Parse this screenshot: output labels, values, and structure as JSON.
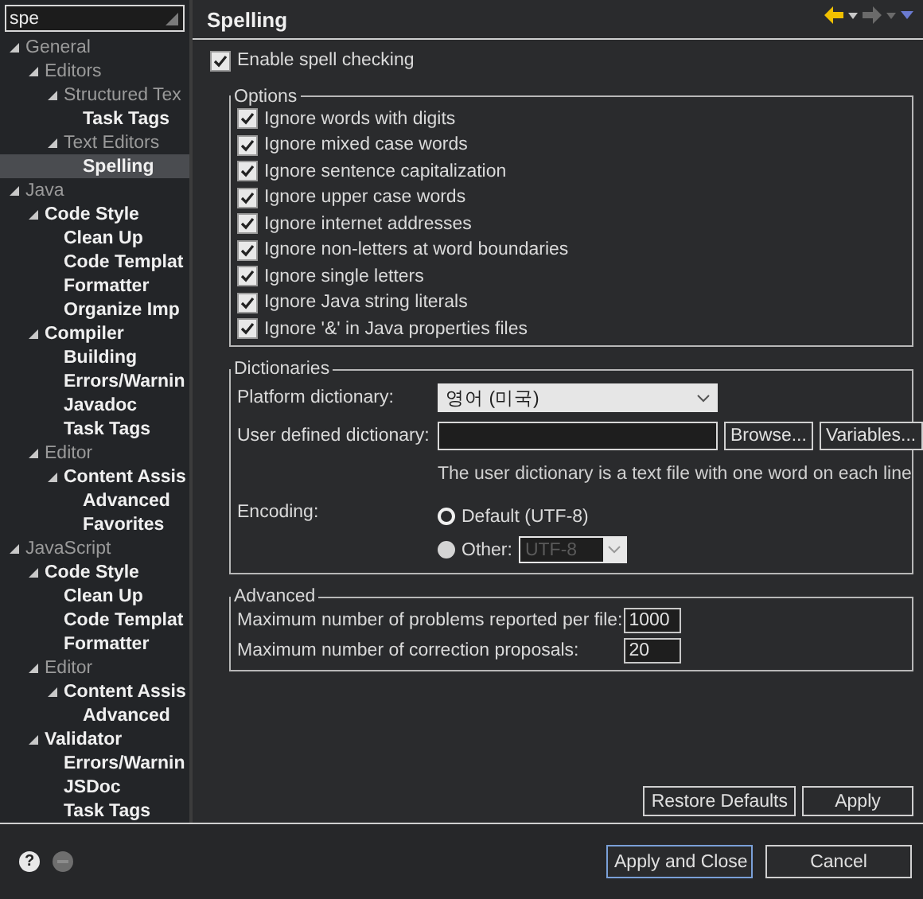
{
  "filter": {
    "value": "spe"
  },
  "tree": [
    {
      "label": "General",
      "matched": false,
      "selected": false,
      "expanded": true,
      "children": [
        {
          "label": "Editors",
          "matched": false,
          "selected": false,
          "expanded": true,
          "children": [
            {
              "label": "Structured Tex",
              "matched": false,
              "selected": false,
              "expanded": true,
              "children": [
                {
                  "label": "Task Tags",
                  "matched": true,
                  "selected": false
                }
              ]
            },
            {
              "label": "Text Editors",
              "matched": false,
              "selected": false,
              "expanded": true,
              "children": [
                {
                  "label": "Spelling",
                  "matched": true,
                  "selected": true
                }
              ]
            }
          ]
        }
      ]
    },
    {
      "label": "Java",
      "matched": false,
      "selected": false,
      "expanded": true,
      "children": [
        {
          "label": "Code Style",
          "matched": true,
          "selected": false,
          "expanded": true,
          "children": [
            {
              "label": "Clean Up",
              "matched": true,
              "selected": false
            },
            {
              "label": "Code Templat",
              "matched": true,
              "selected": false
            },
            {
              "label": "Formatter",
              "matched": true,
              "selected": false
            },
            {
              "label": "Organize Imp",
              "matched": true,
              "selected": false
            }
          ]
        },
        {
          "label": "Compiler",
          "matched": true,
          "selected": false,
          "expanded": true,
          "children": [
            {
              "label": "Building",
              "matched": true,
              "selected": false
            },
            {
              "label": "Errors/Warnin",
              "matched": true,
              "selected": false
            },
            {
              "label": "Javadoc",
              "matched": true,
              "selected": false
            },
            {
              "label": "Task Tags",
              "matched": true,
              "selected": false
            }
          ]
        },
        {
          "label": "Editor",
          "matched": false,
          "selected": false,
          "expanded": true,
          "children": [
            {
              "label": "Content Assis",
              "matched": true,
              "selected": false,
              "expanded": true,
              "children": [
                {
                  "label": "Advanced",
                  "matched": true,
                  "selected": false
                },
                {
                  "label": "Favorites",
                  "matched": true,
                  "selected": false
                }
              ]
            }
          ]
        }
      ]
    },
    {
      "label": "JavaScript",
      "matched": false,
      "selected": false,
      "expanded": true,
      "children": [
        {
          "label": "Code Style",
          "matched": true,
          "selected": false,
          "expanded": true,
          "children": [
            {
              "label": "Clean Up",
              "matched": true,
              "selected": false
            },
            {
              "label": "Code Templat",
              "matched": true,
              "selected": false
            },
            {
              "label": "Formatter",
              "matched": true,
              "selected": false
            }
          ]
        },
        {
          "label": "Editor",
          "matched": false,
          "selected": false,
          "expanded": true,
          "children": [
            {
              "label": "Content Assis",
              "matched": true,
              "selected": false,
              "expanded": true,
              "children": [
                {
                  "label": "Advanced",
                  "matched": true,
                  "selected": false
                }
              ]
            }
          ]
        },
        {
          "label": "Validator",
          "matched": true,
          "selected": false,
          "expanded": true,
          "children": [
            {
              "label": "Errors/Warnin",
              "matched": true,
              "selected": false
            },
            {
              "label": "JSDoc",
              "matched": true,
              "selected": false
            },
            {
              "label": "Task Tags",
              "matched": true,
              "selected": false
            }
          ]
        }
      ]
    }
  ],
  "page": {
    "title": "Spelling"
  },
  "enable_spell_checking": {
    "label": "Enable spell checking",
    "checked": true
  },
  "options": {
    "title": "Options",
    "items": [
      {
        "label": "Ignore words with digits",
        "checked": true
      },
      {
        "label": "Ignore mixed case words",
        "checked": true
      },
      {
        "label": "Ignore sentence capitalization",
        "checked": true
      },
      {
        "label": "Ignore upper case words",
        "checked": true
      },
      {
        "label": "Ignore internet addresses",
        "checked": true
      },
      {
        "label": "Ignore non-letters at word boundaries",
        "checked": true
      },
      {
        "label": "Ignore single letters",
        "checked": true
      },
      {
        "label": "Ignore Java string literals",
        "checked": true
      },
      {
        "label": "Ignore '&' in Java properties files",
        "checked": true
      }
    ]
  },
  "dictionaries": {
    "title": "Dictionaries",
    "platform_label": "Platform dictionary:",
    "platform_value": "영어 (미국)",
    "user_label": "User defined dictionary:",
    "browse": "Browse...",
    "variables": "Variables...",
    "hint": "The user dictionary is a text file with one word on each line",
    "encoding_label": "Encoding:",
    "encodings": [
      {
        "label": "Default (UTF-8)",
        "selected": true
      },
      {
        "label": "Other:",
        "selected": false
      }
    ],
    "other_value": "UTF-8",
    "other_disabled": true
  },
  "advanced": {
    "title": "Advanced",
    "rows": [
      {
        "label": "Maximum number of problems reported per file:",
        "value": "1000"
      },
      {
        "label": "Maximum number of correction proposals:",
        "value": "20"
      }
    ]
  },
  "page_buttons": [
    {
      "label": "Restore Defaults",
      "default": false
    },
    {
      "label": "Apply",
      "default": false
    }
  ],
  "footer": {
    "help": "?",
    "buttons": [
      {
        "label": "Apply and Close",
        "default": true
      },
      {
        "label": "Cancel",
        "default": false
      }
    ]
  }
}
